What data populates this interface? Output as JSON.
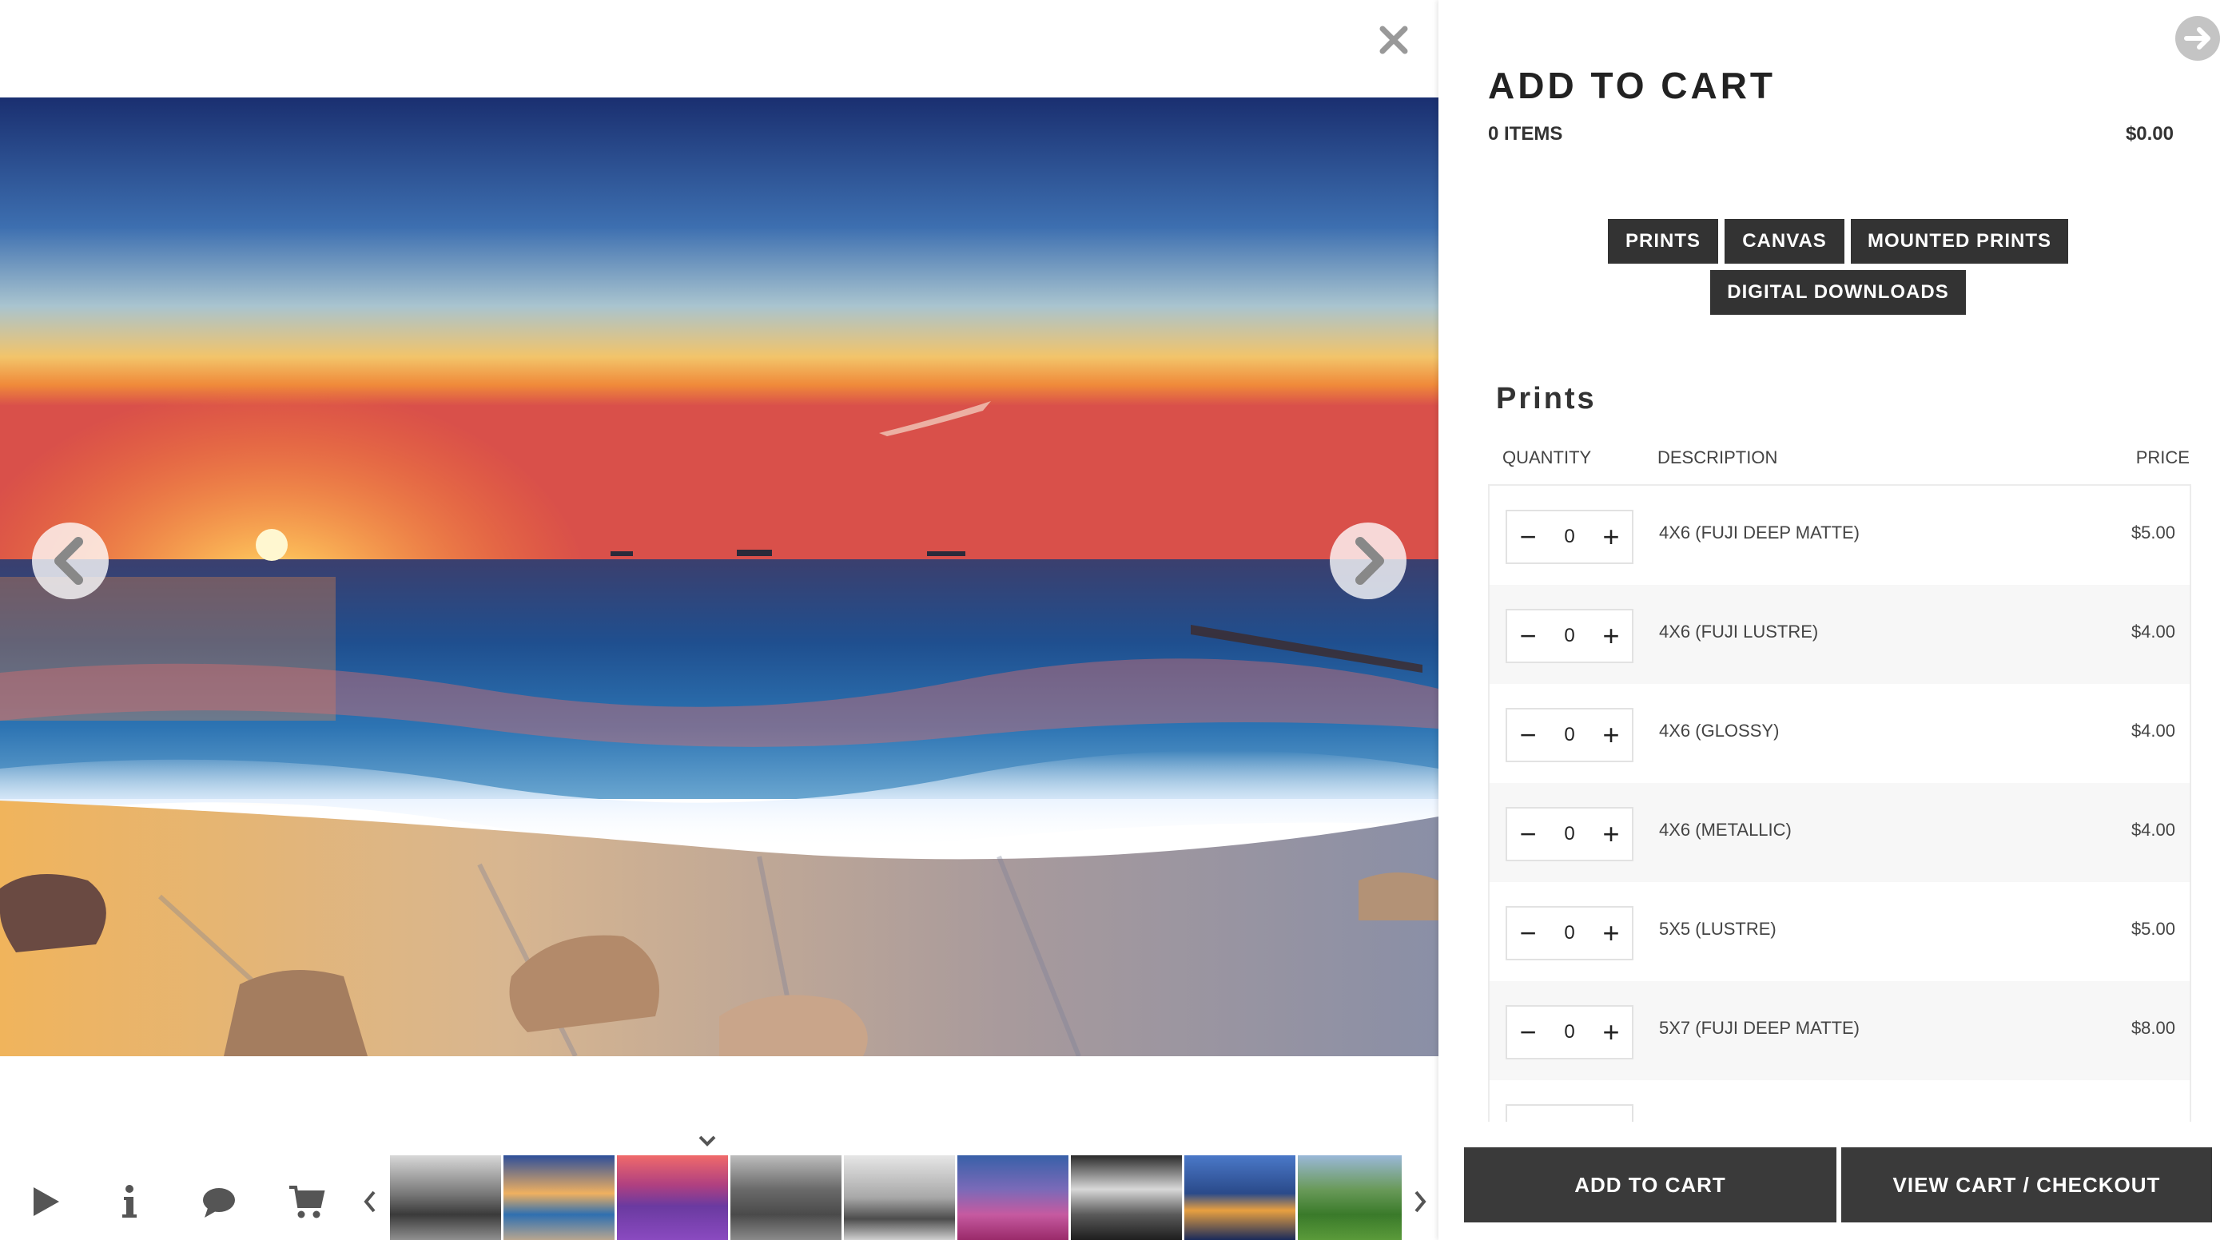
{
  "viewer": {
    "close_icon": "close-icon",
    "prev_icon": "chevron-left-icon",
    "next_icon": "chevron-right-icon",
    "toolbar": {
      "icons": [
        "play-icon",
        "info-icon",
        "comment-icon",
        "cart-icon"
      ],
      "thumb_prev_icon": "chevron-left-icon",
      "thumb_next_icon": "chevron-right-icon",
      "toggle_icon": "chevron-down-icon"
    },
    "thumbnails": [
      "mountain-bw",
      "sunset-beach",
      "lavander-field",
      "rocky-mountains-bw",
      "pier-bw",
      "flower-field",
      "cave-bw",
      "city-skyline-night",
      "green-city"
    ]
  },
  "cart": {
    "title": "ADD TO CART",
    "items_count": "0 ITEMS",
    "total": "$0.00",
    "next_icon": "arrow-right-circle-icon",
    "categories": [
      "PRINTS",
      "CANVAS",
      "MOUNTED PRINTS",
      "DIGITAL DOWNLOADS"
    ],
    "section_title": "Prints",
    "columns": {
      "quantity": "QUANTITY",
      "description": "DESCRIPTION",
      "price": "PRICE"
    },
    "rows": [
      {
        "qty": "0",
        "description": "4X6 (FUJI DEEP MATTE)",
        "price": "$5.00"
      },
      {
        "qty": "0",
        "description": "4X6 (FUJI LUSTRE)",
        "price": "$4.00"
      },
      {
        "qty": "0",
        "description": "4X6 (GLOSSY)",
        "price": "$4.00"
      },
      {
        "qty": "0",
        "description": "4X6 (METALLIC)",
        "price": "$4.00"
      },
      {
        "qty": "0",
        "description": "5X5 (LUSTRE)",
        "price": "$5.00"
      },
      {
        "qty": "0",
        "description": "5X7 (FUJI DEEP MATTE)",
        "price": "$8.00"
      },
      {
        "qty": "",
        "description": "",
        "price": ""
      }
    ],
    "add_to_cart_label": "ADD TO CART",
    "view_cart_label": "VIEW CART / CHECKOUT",
    "colors": {
      "button_dark": "#333333",
      "footer_button": "#3a3a3a"
    }
  }
}
